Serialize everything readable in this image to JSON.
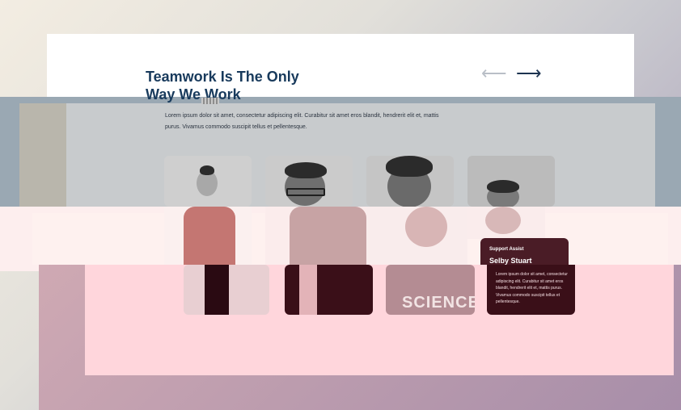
{
  "section": {
    "heading_line1": "Teamwork Is The Only",
    "heading_line2": "Way We Work",
    "intro_line1": "Lorem ipsum dolor sit amet, consectetur adipiscing elit. Curabitur sit amet eros blandit, hendrerit elit et, mattis",
    "intro_line2": "purus. Vivamus commodo suscipit tellus et pellentesque."
  },
  "nav": {
    "prev_arrow": "⟵",
    "next_arrow": "⟶"
  },
  "featured_member": {
    "role": "Support Assist",
    "name": "Selby Stuart",
    "bio": "Lorem ipsum dolor sit amet, consectetur adipiscing elit. Curabitur sit amet eros blandit, hendrerit elit et, mattis purus. Vivamus commodo suscipit tellus et pellentesque."
  },
  "shirt_text": "SCIENCE",
  "icons": [
    "arrow-left-icon",
    "arrow-right-icon"
  ],
  "colors": {
    "heading": "#183a5c",
    "overlay": "#3a0f18"
  }
}
